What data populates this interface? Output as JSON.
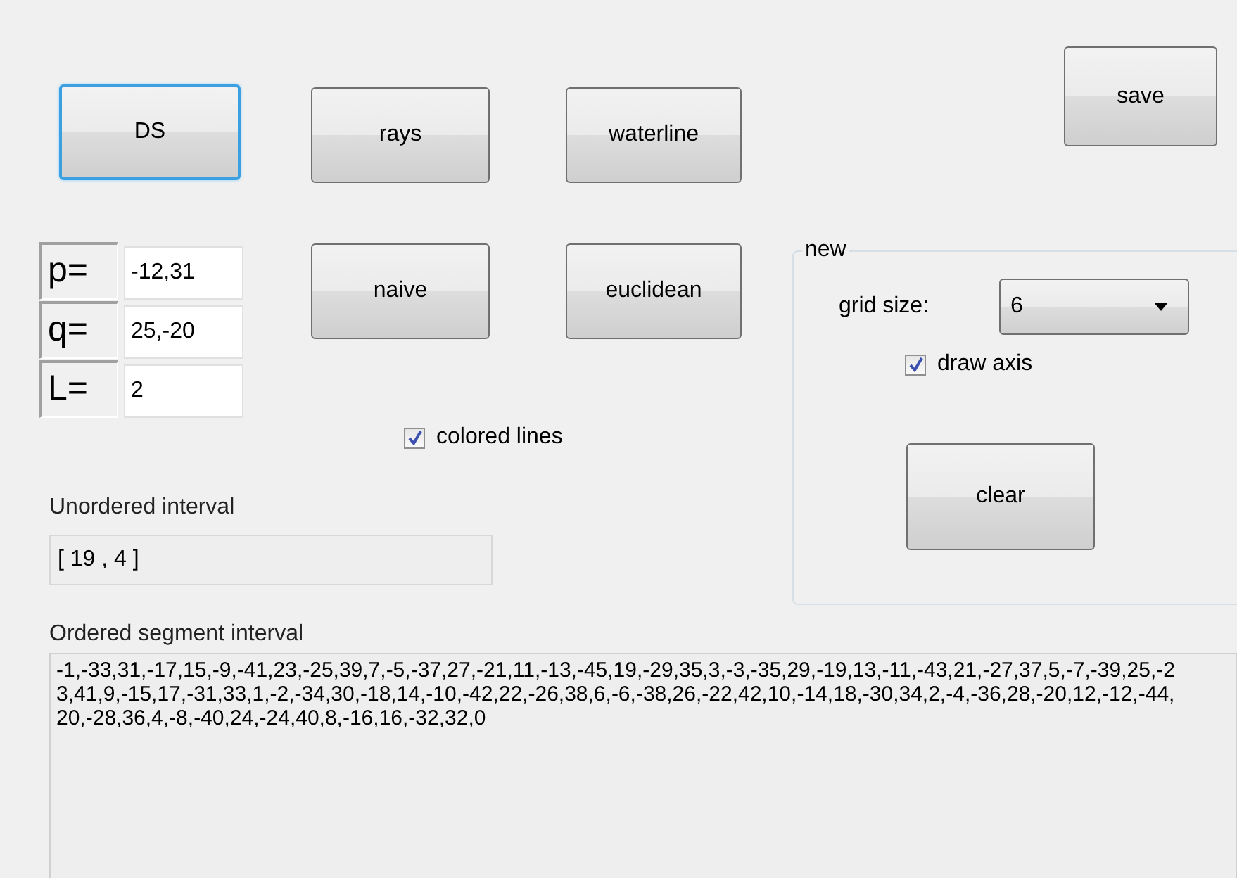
{
  "top_buttons": [
    {
      "label": "DS",
      "focused": true
    },
    {
      "label": "rays",
      "focused": false
    },
    {
      "label": "waterline",
      "focused": false
    }
  ],
  "save_button": {
    "label": "save"
  },
  "params": [
    {
      "label": "p=",
      "value": "-12,31"
    },
    {
      "label": "q=",
      "value": "25,-20"
    },
    {
      "label": "L=",
      "value": "2"
    }
  ],
  "mid_buttons": [
    {
      "label": "naive"
    },
    {
      "label": "euclidean"
    }
  ],
  "colored_lines": {
    "label": "colored lines",
    "checked": true
  },
  "group": {
    "title": "new",
    "grid_size": {
      "label": "grid size:",
      "value": "6"
    },
    "draw_axis": {
      "label": "draw axis",
      "checked": true
    },
    "clear_button": {
      "label": "clear"
    }
  },
  "unordered": {
    "label": "Unordered interval",
    "value": "[ 19 , 4 ]"
  },
  "ordered": {
    "label": "Ordered segment interval",
    "value": "-1,-33,31,-17,15,-9,-41,23,-25,39,7,-5,-37,27,-21,11,-13,-45,19,-29,35,3,-3,-35,29,-19,13,-11,-43,21,-27,37,5,-7,-39,25,-23,41,9,-15,17,-31,33,1,-2,-34,30,-18,14,-10,-42,22,-26,38,6,-6,-38,26,-22,42,10,-14,18,-30,34,2,-4,-36,28,-20,12,-12,-44,20,-28,36,4,-8,-40,24,-24,40,8,-16,16,-32,32,0"
  }
}
